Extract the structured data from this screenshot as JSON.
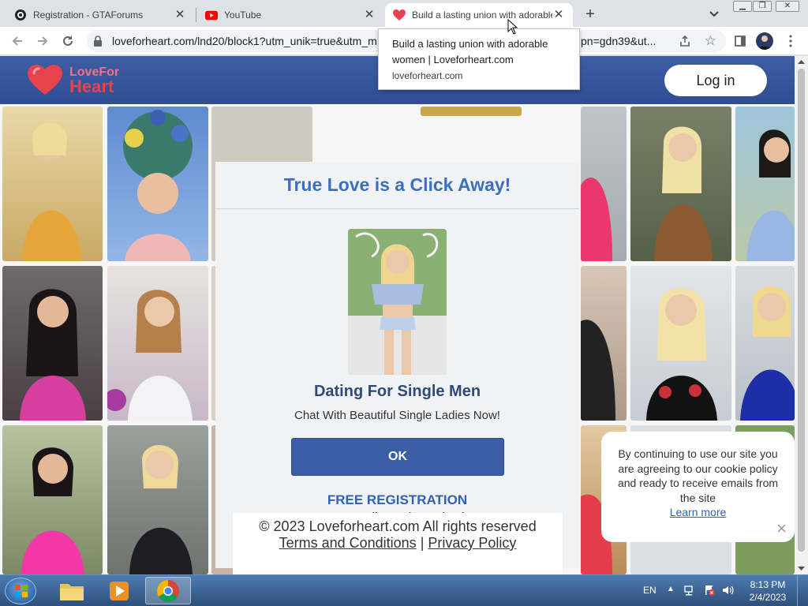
{
  "browser": {
    "tabs": [
      {
        "title": "Registration - GTAForums",
        "icon": "gtaforums-icon"
      },
      {
        "title": "YouTube",
        "icon": "youtube-icon"
      },
      {
        "title": "Build a lasting union with adorable women | Loveforheart.com",
        "icon": "heart-icon"
      }
    ],
    "url_visible_start": "loveforheart.com/lnd20/block1?utm_unik=true&utm_m",
    "url_visible_end": "pn=gdn39&ut...",
    "tooltip": {
      "title": "Build a lasting union with adorable women | Loveforheart.com",
      "url": "loveforheart.com"
    }
  },
  "site": {
    "logo_line1": "LoveFor",
    "logo_line2": "Heart",
    "login_label": "Log in",
    "modal": {
      "title": "True Love is a Click Away!",
      "heading": "Dating For Single Men",
      "subheading": "Chat With Beautiful Single Ladies Now!",
      "ok_label": "OK",
      "free_registration": "FREE REGISTRATION",
      "no_credit_card": "no credit card required"
    },
    "footer": {
      "copyright": "© 2023 Loveforheart.com All rights reserved",
      "terms": "Terms and Conditions",
      "separator": "|",
      "privacy": "Privacy Policy"
    },
    "cookie": {
      "text": "By continuing to use our site you are agreeing to our cookie policy and ready to receive emails from the site",
      "learn_more": "Learn more",
      "close": "×"
    }
  },
  "taskbar": {
    "language": "EN",
    "time": "8:13 PM",
    "date": "2/4/2023"
  },
  "colors": {
    "site_header": "#3b5998",
    "modal_title": "#3b6fc0",
    "ok_button": "#3b5ea7",
    "free_registration": "#2f63b4",
    "logo_pink": "#e8424f"
  }
}
